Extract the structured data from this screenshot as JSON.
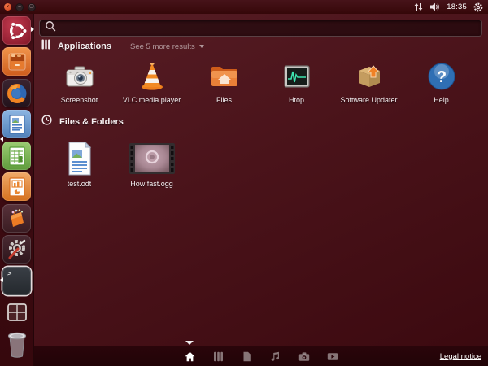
{
  "panel": {
    "window_controls": {
      "close": "×",
      "minimize": "–",
      "maximize": "▢"
    },
    "time": "18:35",
    "tray_icons": [
      "network-arrows-icon",
      "volume-icon",
      "session-gear-icon"
    ]
  },
  "launcher": {
    "items": [
      {
        "icon": "ubuntu-dash-icon",
        "state": "focused"
      },
      {
        "icon": "files-drawer-icon"
      },
      {
        "icon": "firefox-icon"
      },
      {
        "icon": "libreoffice-writer-icon",
        "state": "running"
      },
      {
        "icon": "libreoffice-calc-icon"
      },
      {
        "icon": "libreoffice-impress-icon"
      },
      {
        "icon": "software-center-icon"
      },
      {
        "icon": "system-settings-icon"
      },
      {
        "icon": "terminal-icon",
        "state": "running"
      },
      {
        "icon": "workspace-switcher-icon"
      },
      {
        "icon": "trash-icon"
      }
    ],
    "terminal_glyph": ">_"
  },
  "dash": {
    "search": {
      "value": "",
      "placeholder": ""
    },
    "sections": [
      {
        "title": "Applications",
        "expander": "See 5 more results",
        "items": [
          {
            "label": "Screenshot",
            "icon": "camera-app-icon"
          },
          {
            "label": "VLC media player",
            "icon": "vlc-cone-icon"
          },
          {
            "label": "Files",
            "icon": "home-folder-icon"
          },
          {
            "label": "Htop",
            "icon": "htop-monitor-icon"
          },
          {
            "label": "Software Updater",
            "icon": "updater-box-icon"
          },
          {
            "label": "Help",
            "icon": "help-question-icon"
          }
        ]
      },
      {
        "title": "Files & Folders",
        "items": [
          {
            "label": "test.odt",
            "icon": "writer-document-icon"
          },
          {
            "label": "How fast.ogg",
            "icon": "video-filmstrip-icon"
          }
        ]
      }
    ],
    "footer": {
      "lenses": [
        "home",
        "applications",
        "files",
        "music",
        "photos",
        "video"
      ],
      "active_lens": "home",
      "legal": "Legal notice"
    }
  },
  "colors": {
    "accent_orange": "#dd4814",
    "panel_bg": "#3d0d13",
    "dash_bg_top": "#571d25",
    "dash_bg_bottom": "#3b090f",
    "lens_bar_bg": "#26040a",
    "close_button": "#cf3f1e",
    "htop_wave": "#3ee6b0",
    "help_blue": "#2f6fb4"
  }
}
